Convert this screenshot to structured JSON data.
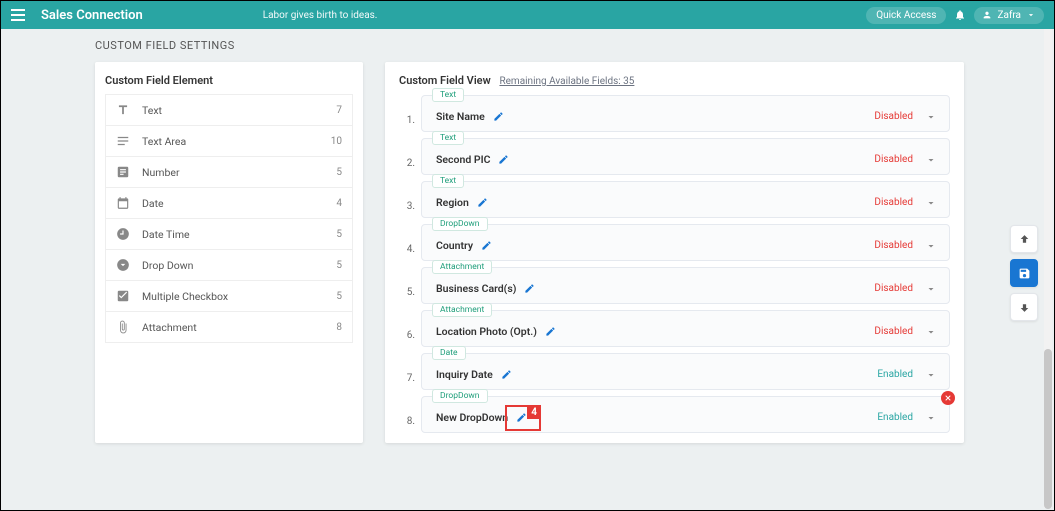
{
  "header": {
    "brand": "Sales Connection",
    "tagline": "Labor gives birth to ideas.",
    "quick_access": "Quick Access",
    "user_name": "Zafra"
  },
  "page_title": "CUSTOM FIELD SETTINGS",
  "left_panel": {
    "title": "Custom Field Element",
    "items": [
      {
        "icon": "text",
        "label": "Text",
        "count": "7"
      },
      {
        "icon": "textarea",
        "label": "Text Area",
        "count": "10"
      },
      {
        "icon": "number",
        "label": "Number",
        "count": "5"
      },
      {
        "icon": "date",
        "label": "Date",
        "count": "4"
      },
      {
        "icon": "datetime",
        "label": "Date Time",
        "count": "5"
      },
      {
        "icon": "dropdown",
        "label": "Drop Down",
        "count": "5"
      },
      {
        "icon": "checkbox",
        "label": "Multiple Checkbox",
        "count": "5"
      },
      {
        "icon": "attachment",
        "label": "Attachment",
        "count": "8"
      }
    ]
  },
  "right_panel": {
    "title": "Custom Field View",
    "remaining": "Remaining Available Fields: 35",
    "fields": [
      {
        "num": "1.",
        "tag": "Text",
        "name": "Site Name",
        "status": "Disabled",
        "status_class": "status-disabled",
        "deletable": false
      },
      {
        "num": "2.",
        "tag": "Text",
        "name": "Second PIC",
        "status": "Disabled",
        "status_class": "status-disabled",
        "deletable": false
      },
      {
        "num": "3.",
        "tag": "Text",
        "name": "Region",
        "status": "Disabled",
        "status_class": "status-disabled",
        "deletable": false
      },
      {
        "num": "4.",
        "tag": "DropDown",
        "name": "Country",
        "status": "Disabled",
        "status_class": "status-disabled",
        "deletable": false
      },
      {
        "num": "5.",
        "tag": "Attachment",
        "name": "Business Card(s)",
        "status": "Disabled",
        "status_class": "status-disabled",
        "deletable": false
      },
      {
        "num": "6.",
        "tag": "Attachment",
        "name": "Location Photo (Opt.)",
        "status": "Disabled",
        "status_class": "status-disabled",
        "deletable": false
      },
      {
        "num": "7.",
        "tag": "Date",
        "name": "Inquiry Date",
        "status": "Enabled",
        "status_class": "status-enabled",
        "deletable": false
      },
      {
        "num": "8.",
        "tag": "DropDown",
        "name": "New DropDown",
        "status": "Enabled",
        "status_class": "status-enabled",
        "deletable": true
      }
    ]
  },
  "callout_number": "4"
}
